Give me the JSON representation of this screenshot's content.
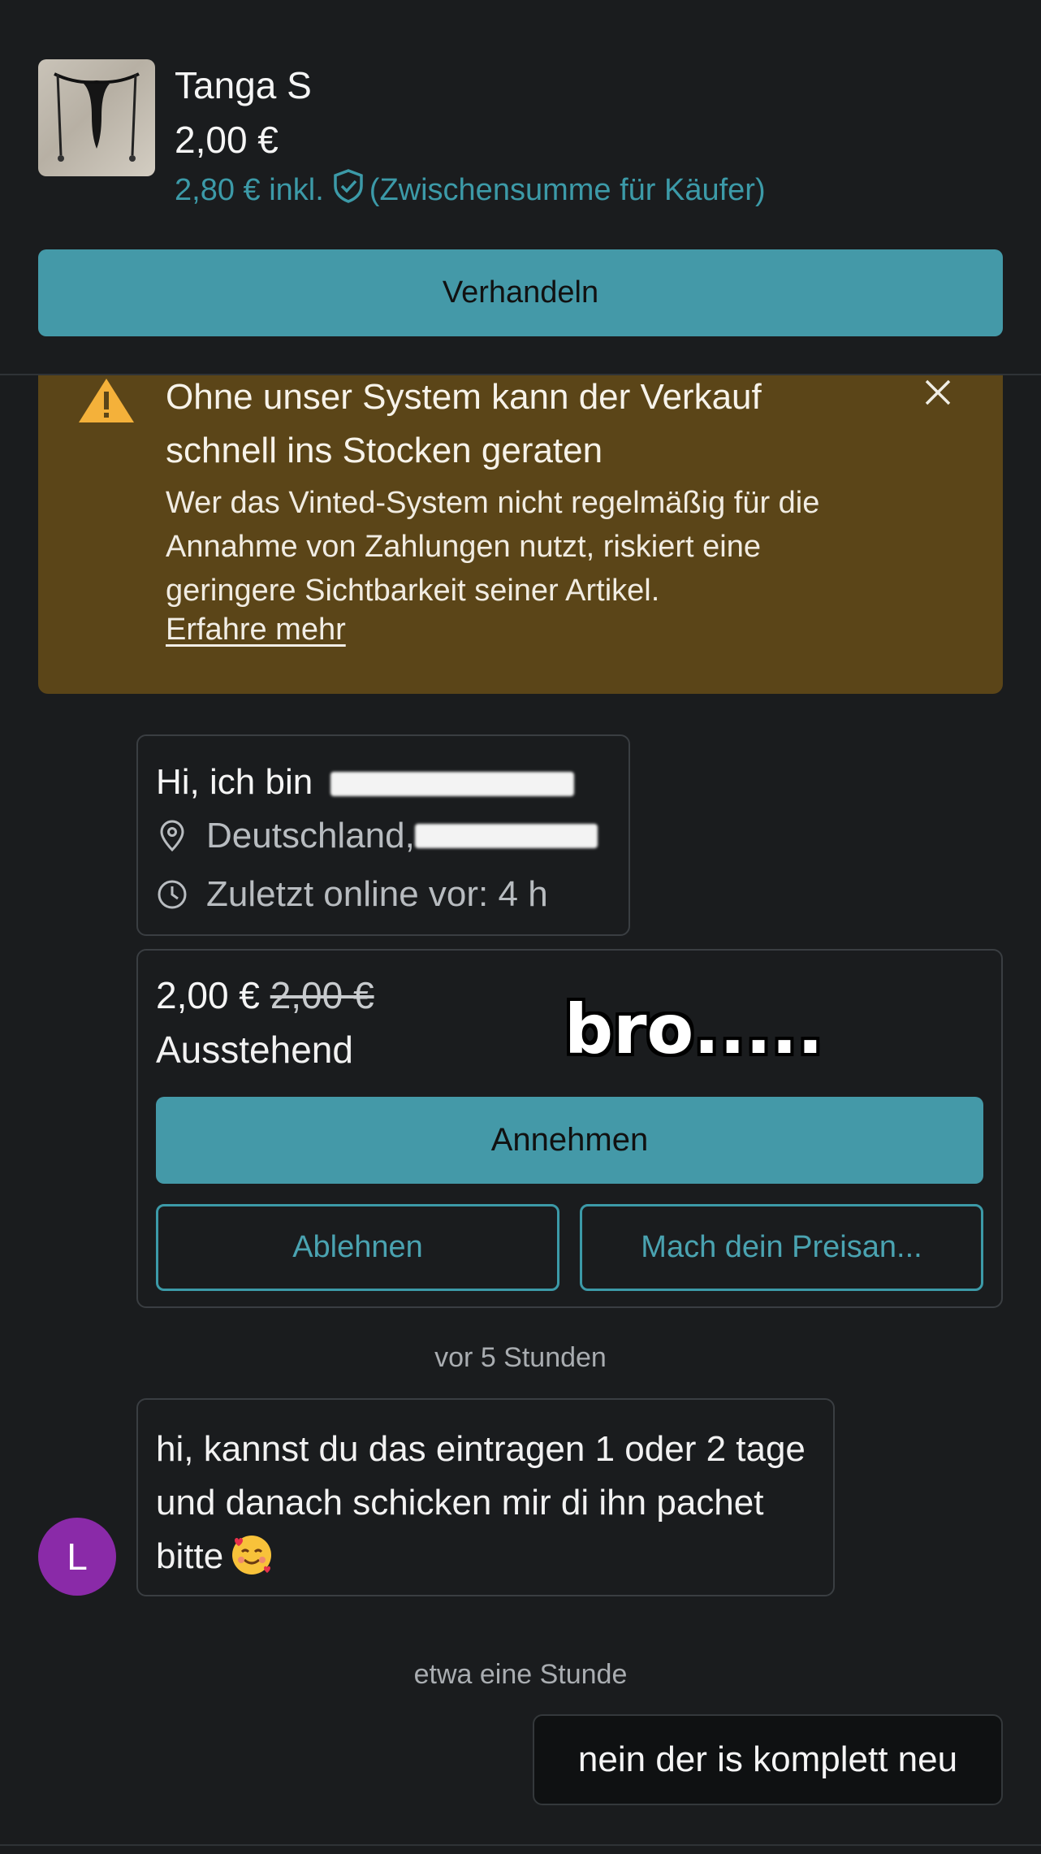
{
  "item": {
    "title": "Tanga S",
    "price": "2,00 €",
    "buyer_price": "2,80 € inkl.",
    "buyer_note": "(Zwischensumme für Käufer)",
    "thumbnail_icon": "product-photo"
  },
  "actions": {
    "negotiate_label": "Verhandeln"
  },
  "banner": {
    "title": "Ohne unser System kann der Verkauf schnell ins Stocken geraten",
    "text": "Wer das Vinted-System nicht regelmäßig für die Annahme von Zahlungen nutzt, riskiert eine geringere Sichtbarkeit seiner Artikel.",
    "link": "Erfahre mehr",
    "close_icon": "close-icon",
    "warning_icon": "warning-icon",
    "color": "#5b4518"
  },
  "seller": {
    "intro": "Hi, ich bin",
    "location": "Deutschland,",
    "last_online": "Zuletzt online vor: 4 h"
  },
  "offer": {
    "price": "2,00 €",
    "original_price": "2,00 €",
    "status": "Ausstehend",
    "overlay": "bro.....",
    "accept_label": "Annehmen",
    "decline_label": "Ablehnen",
    "counter_label": "Mach dein Preisan..."
  },
  "timestamps": {
    "first": "vor 5 Stunden",
    "second": "etwa eine Stunde"
  },
  "messages": {
    "incoming": {
      "avatar_letter": "L",
      "text": "hi, kannst du das eintragen 1 oder 2 tage und danach schicken mir di ihn pachet bitte",
      "emoji": "smiling-face-with-hearts"
    },
    "outgoing": {
      "text": "nein der is komplett neu"
    }
  },
  "colors": {
    "background": "#1a1c1e",
    "accent": "#4499a8",
    "avatar": "#8a2aa8"
  }
}
